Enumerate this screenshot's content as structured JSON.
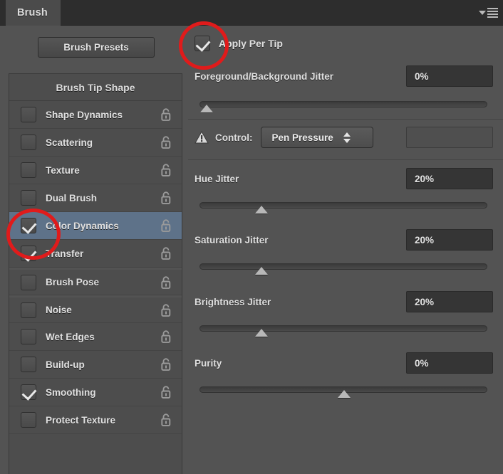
{
  "panel": {
    "tab_label": "Brush",
    "menu_icon": "panel-menu-icon",
    "presets_button": "Brush Presets"
  },
  "sidebar": {
    "header": "Brush Tip Shape",
    "items": [
      {
        "label": "Shape Dynamics",
        "checked": false,
        "selected": false,
        "lock": "unlock-icon"
      },
      {
        "label": "Scattering",
        "checked": false,
        "selected": false,
        "lock": "unlock-icon"
      },
      {
        "label": "Texture",
        "checked": false,
        "selected": false,
        "lock": "unlock-icon"
      },
      {
        "label": "Dual Brush",
        "checked": false,
        "selected": false,
        "lock": "unlock-icon"
      },
      {
        "label": "Color Dynamics",
        "checked": true,
        "selected": true,
        "lock": "unlock-icon"
      },
      {
        "label": "Transfer",
        "checked": true,
        "selected": false,
        "lock": "unlock-icon"
      },
      {
        "label": "Brush Pose",
        "checked": false,
        "selected": false,
        "lock": "unlock-icon"
      },
      {
        "label": "Noise",
        "checked": false,
        "selected": false,
        "lock": "unlock-icon"
      },
      {
        "label": "Wet Edges",
        "checked": false,
        "selected": false,
        "lock": "unlock-icon"
      },
      {
        "label": "Build-up",
        "checked": false,
        "selected": false,
        "lock": "unlock-icon"
      },
      {
        "label": "Smoothing",
        "checked": true,
        "selected": false,
        "lock": "unlock-icon"
      },
      {
        "label": "Protect Texture",
        "checked": false,
        "selected": false,
        "lock": "unlock-icon"
      }
    ]
  },
  "options": {
    "apply_per_tip": {
      "label": "Apply Per Tip",
      "checked": true
    },
    "fg_bg_jitter": {
      "label": "Foreground/Background Jitter",
      "value": "0%",
      "slider_percent": 0
    },
    "control": {
      "warning_icon": "warning-triangle-icon",
      "label": "Control:",
      "selected": "Pen Pressure",
      "secondary_value": ""
    },
    "hue_jitter": {
      "label": "Hue Jitter",
      "value": "20%",
      "slider_percent": 20
    },
    "saturation_jitter": {
      "label": "Saturation Jitter",
      "value": "20%",
      "slider_percent": 20
    },
    "brightness_jitter": {
      "label": "Brightness Jitter",
      "value": "20%",
      "slider_percent": 20
    },
    "purity": {
      "label": "Purity",
      "value": "0%",
      "slider_percent": 50
    }
  },
  "annotations": {
    "circle_apply_per_tip": "red-circle-annotation",
    "circle_color_dynamics": "red-circle-annotation",
    "color": "#e01b1b"
  }
}
